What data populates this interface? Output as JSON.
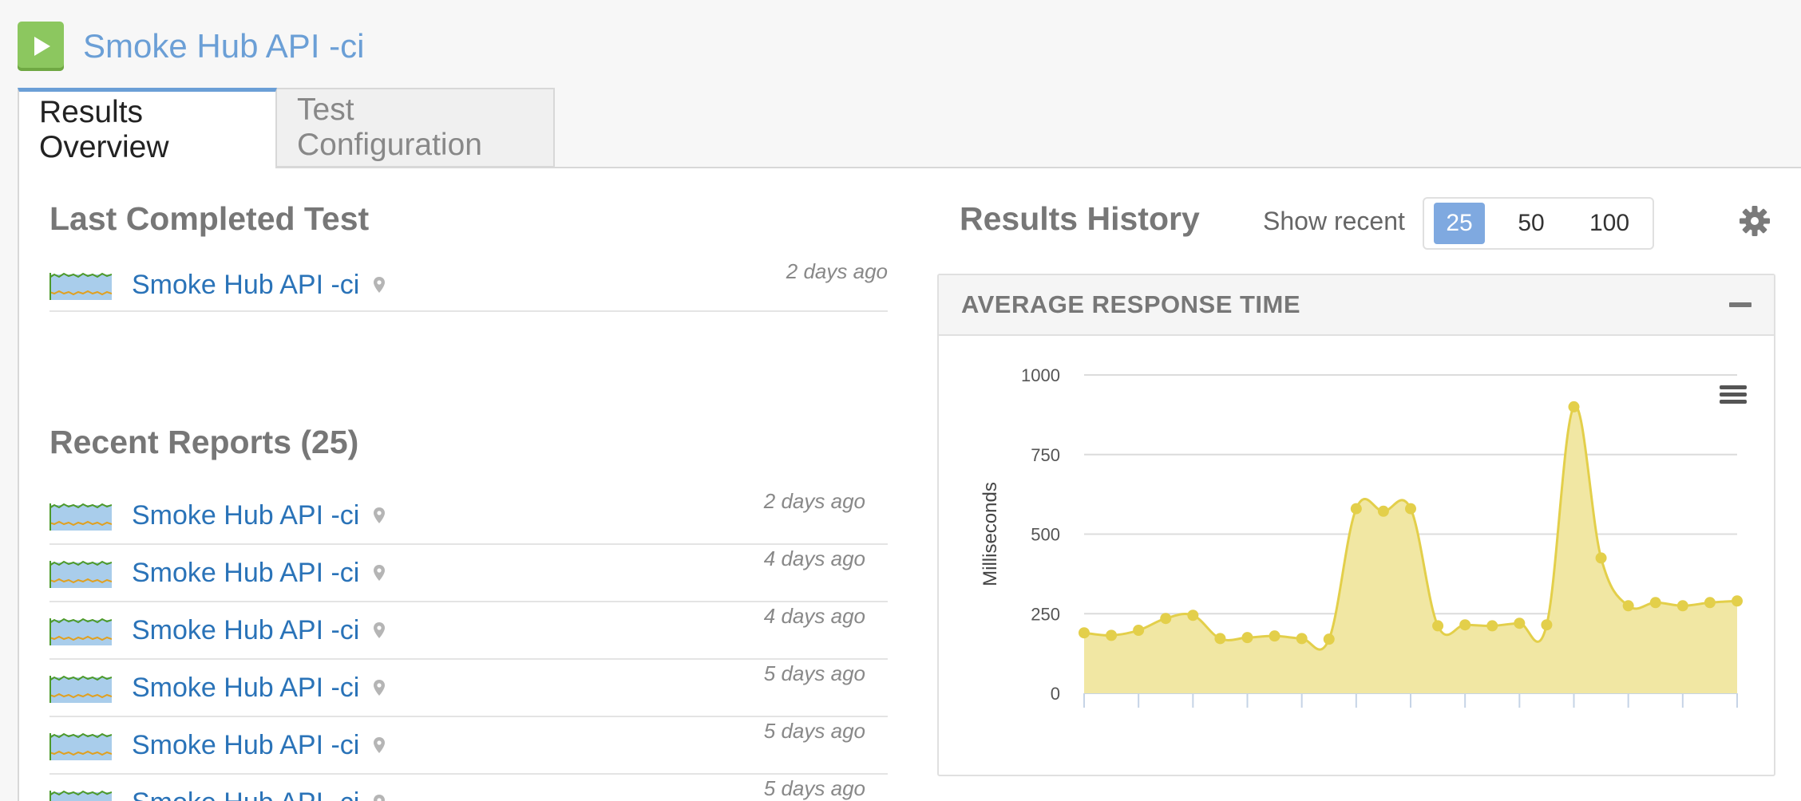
{
  "app": {
    "title": "Smoke Hub API -ci",
    "run_icon": "play-icon"
  },
  "tabs": [
    {
      "label": "Results Overview",
      "active": true
    },
    {
      "label": "Test Configuration",
      "active": false
    }
  ],
  "last_completed": {
    "heading": "Last Completed Test",
    "item": {
      "name": "Smoke Hub API -ci",
      "ago": "2 days ago",
      "location_icon": "map-pin-icon"
    }
  },
  "recent": {
    "heading": "Recent Reports (25)",
    "items": [
      {
        "name": "Smoke Hub API -ci",
        "ago": "2 days ago"
      },
      {
        "name": "Smoke Hub API -ci",
        "ago": "4 days ago"
      },
      {
        "name": "Smoke Hub API -ci",
        "ago": "4 days ago"
      },
      {
        "name": "Smoke Hub API -ci",
        "ago": "5 days ago"
      },
      {
        "name": "Smoke Hub API -ci",
        "ago": "5 days ago"
      },
      {
        "name": "Smoke Hub API -ci",
        "ago": "5 days ago"
      }
    ]
  },
  "history": {
    "heading": "Results History",
    "show_recent_label": "Show recent",
    "options": [
      "25",
      "50",
      "100"
    ],
    "selected": "25",
    "settings_icon": "gear-icon"
  },
  "chart_card": {
    "title": "AVERAGE RESPONSE TIME",
    "collapse_icon": "minus-icon",
    "menu_icon": "hamburger-menu-icon"
  },
  "colors": {
    "accent": "#6b9fd6",
    "link": "#2a73b8",
    "run_button": "#8cc75f",
    "series_line": "#e3cf4a",
    "series_fill": "#f1e7a3"
  },
  "chart_data": {
    "type": "area",
    "ylabel": "Milliseconds",
    "ylim": [
      0,
      1000
    ],
    "yticks": [
      0,
      250,
      500,
      750,
      1000
    ],
    "grid": true,
    "series": [
      {
        "values": [
          190,
          182,
          198,
          235,
          245,
          172,
          175,
          180,
          172,
          170,
          580,
          572,
          580,
          212,
          215,
          212,
          220,
          215,
          900,
          425,
          275,
          285,
          275,
          285,
          290
        ]
      }
    ]
  }
}
